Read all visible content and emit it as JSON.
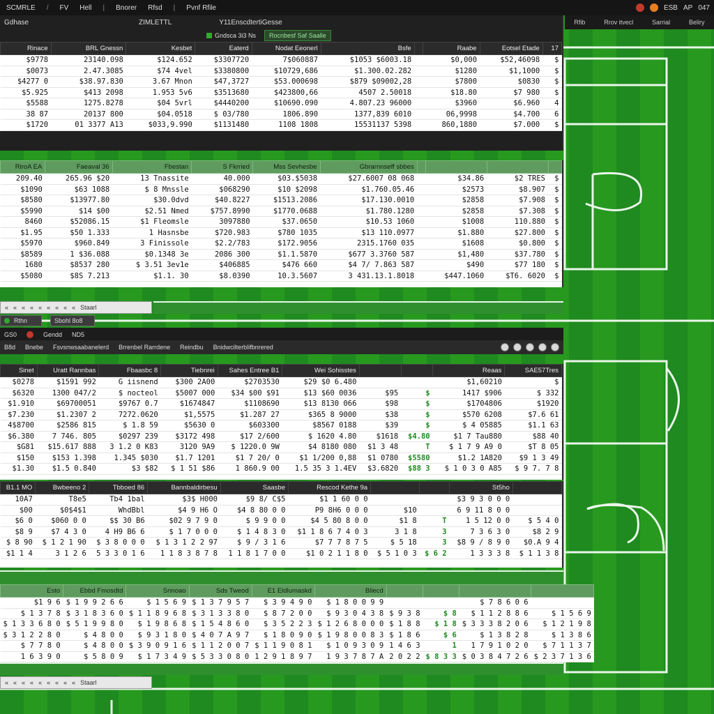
{
  "topbar": {
    "menu": [
      "SCMRLE",
      "/",
      "FV",
      "Hell",
      "|",
      "Bnorer",
      "Rfsd",
      "|",
      "Pvnf Rfile"
    ],
    "right_text": [
      "ESB",
      "AP",
      "047"
    ]
  },
  "subbar_right": [
    "Rfib",
    "Rrov itvecl",
    "Sarrial",
    "Beliry"
  ],
  "panel1": {
    "head_left": "Gdhase",
    "head_mid": "ZIMLETTL",
    "head_right": "Y11EnscdtertiGesse",
    "tab_a": "Gndsca 3i3 Ns",
    "tab_b": "Rocnbesf Saf Saalle",
    "columns": [
      "Rinace",
      "BRL Gnessn",
      "Kesbet",
      "Eaterd",
      "Nodat Eeonerl",
      "Bsfe",
      "",
      "Raabe",
      "Eotsel Etade",
      "17"
    ],
    "rows": [
      [
        "$9778",
        "23140.098",
        "$124.652",
        "$3307720",
        "7$060887",
        "$1053 $6003.18",
        "",
        "$0,000",
        "$52,46098",
        "$"
      ],
      [
        "$0073",
        "2.47.3085",
        "$74 4vel",
        "$3380800",
        "$10729,686",
        "$1.300.02.282",
        "",
        "$1280",
        "$1,1000",
        "$"
      ],
      [
        "$4277 0",
        "$38.97.830",
        "3.67 Mnon",
        "$47,3727",
        "$53.000698",
        "$879 $09002,28",
        "",
        "$7800",
        "$0830",
        "$"
      ],
      [
        "$5.925",
        "$413 2098",
        "1.953 5v6",
        "$3513680",
        "$423800,66",
        "4507 2.50018",
        "",
        "$18.80",
        "$7 980",
        "$"
      ],
      [
        "$5588",
        "1275.8278",
        "$04 5vrl",
        "$4440200",
        "$10690.090",
        "4.807.23 96000",
        "",
        "$3960",
        "$6.960",
        "4"
      ],
      [
        "38 87",
        "20137 800",
        "$04.0518",
        "$ 03/780",
        "1806.890",
        "1377,839 6010",
        "",
        "06,9998",
        "$4.700",
        "6"
      ],
      [
        "$1720",
        "01 3377 A13",
        "$033,9.990",
        "$1131480",
        "1108 1808",
        "15531137 5398",
        "",
        "860,1880",
        "$7.000",
        "$"
      ]
    ]
  },
  "panel2": {
    "columns": [
      "RiroA EA",
      "Faeaval 36",
      "Fbestan",
      "S Fkrried",
      "Mss Sevhesbe",
      "Gbrarnnseff sbbes",
      "",
      "",
      "",
      ""
    ],
    "rows": [
      [
        "209.40",
        "265.96 $20",
        "13 Tnassite",
        "40.000",
        "$03.$5038",
        "$27.6007 08 068",
        "",
        "$34.86",
        "$2 TRES",
        "$"
      ],
      [
        "$1090",
        "$63 1088",
        "$ 8 Mnssle",
        "$068290",
        "$10 $2098",
        "$1.760.05.46",
        "",
        "$2573",
        "$8.907",
        "$"
      ],
      [
        "$8580",
        "$13977.80",
        "$30.0dvd",
        "$40.8227",
        "$1513.2086",
        "$17.130.0010",
        "",
        "$2858",
        "$7.908",
        "$"
      ],
      [
        "$5990",
        "$14 $00",
        "$2.51 Nmed",
        "$757.8990",
        "$1770.0688",
        "$1.780.1280",
        "",
        "$2858",
        "$7.308",
        "$"
      ],
      [
        "8460",
        "$52086.15",
        "$1 Fleomsle",
        "3097880",
        "$37.0650",
        "$10.53 1060",
        "",
        "$1008",
        "110.880",
        "$"
      ],
      [
        "$1.95",
        "$50 1.333",
        "1 Hasnsbe",
        "$720.983",
        "$780 1035",
        "$13 110.0977",
        "",
        "$1.880",
        "$27.800",
        "$"
      ],
      [
        "$5970",
        "$960.849",
        "3 Finissole",
        "$2.2/783",
        "$172.9056",
        "2315.1760 035",
        "",
        "$1608",
        "$0.800",
        "$"
      ],
      [
        "$8589",
        "1 $36.088",
        "$0.1348 3e",
        "2086 300",
        "$1.1.5870",
        "$677 3.3760 587",
        "",
        "$1,480",
        "$37.780",
        "$"
      ],
      [
        "1680",
        "$8537 280",
        "$ 3.51 3ev1e",
        "$406885",
        "$476 660",
        "$4 7/ 7.863 587",
        "",
        "$490",
        "$77 180",
        "$"
      ],
      [
        "$5080",
        "$8S 7.213",
        "$1.1. 30",
        "$8.0390",
        "10.3.5607",
        "3 431.13.1.8018",
        "",
        "$447.1060",
        "$T6. 6020",
        "$"
      ]
    ]
  },
  "mini_tabs_1": [
    "«",
    "«",
    "«",
    "«",
    "«",
    "«",
    "«",
    "«",
    "«",
    "Staarl"
  ],
  "section2": {
    "sel_left": "Rthn",
    "sel_right": "Sbohl 8o8",
    "toolbar_a": [
      "GS0",
      "Gendd",
      "ND5"
    ],
    "toolbar_b": [
      "B8d",
      "Bnebe",
      "Fsvsnwsaabanelerd",
      "Brrenbel Rarrdene",
      "Reindbu",
      "Bnidwcilterblifbnrered"
    ]
  },
  "panel3": {
    "columns": [
      "Sinet",
      "Uratt Rannbas",
      "Fbaasbc 8",
      "Tiebnrei",
      "Sahes Entree B1",
      "Wei Sohisstes",
      "",
      "",
      "Reaas",
      "SAE57Tres"
    ],
    "rows": [
      [
        "$0278",
        "$1591 992",
        "G iisnend",
        "$300 2A00",
        "$2703530",
        "$29 $0 6.480",
        "",
        "",
        "$1,60210",
        "$"
      ],
      [
        "$6320",
        "1300 047/2",
        "$ nocteol",
        "$5007 000",
        "$34 $00 $91",
        "$13 $60 0036",
        "$95",
        "$",
        "1417 $906",
        "$ 332"
      ],
      [
        "$1.910",
        "$69700051",
        "$9767 0.7",
        "$1674847",
        "$1108690",
        "$13 8130 066",
        "$98",
        "$",
        "$1704806",
        "$1920"
      ],
      [
        "$7.230",
        "$1.2307 2",
        "7272.0620",
        "$1,5575",
        "$1.287 27",
        "$365 8 9000",
        "$38",
        "$",
        "$570 6208",
        "$7.6 61"
      ],
      [
        "4$8700",
        "$2586 815",
        "$ 1.8 59",
        "$5630 0",
        "$603300",
        "$8567 0188",
        "$39",
        "$",
        "$ 4 05885",
        "$1.1 63"
      ],
      [
        "$6.380",
        "7 746. 805",
        "$0297 239",
        "$3172 498",
        "$17 2/600",
        "$ 1620 4.80",
        "$1618",
        "$4.80",
        "$1 7 Tau880",
        "$88 40"
      ],
      [
        "$G81",
        "$15.617 888",
        "3 1.2 0 K83",
        "3120 9A9",
        "$ 1220.0 9W",
        "$4 8180 080",
        "$1 3 48",
        "T",
        "$ 1 7 9 A9 0",
        "$T 8 05"
      ],
      [
        "$150",
        "$153 1.398",
        "1.345 $030",
        "$1.7 1201",
        "$1 7 20/ 0",
        "$1 1/200 0,88",
        "$1 0780",
        "$5580",
        "$1.2 1A820",
        "$9 1 3 49"
      ],
      [
        "$1.30",
        "$1.5 0.840",
        "$3 $82",
        "$ 1 51 $86",
        "1 860.9 00",
        "1.5 35 3 1.4EV",
        "$3.6820",
        "$88 3",
        "$ 1 0 3 0 A85",
        "$ 9 7. 7 8"
      ]
    ]
  },
  "panel4": {
    "columns": [
      "B1.1 MO",
      "Bwbeeno 2",
      "Tbboed 86",
      "Bannbaldirbesu",
      "Saasbe",
      "Rescod Kethe 9a",
      "",
      "",
      "St5ho",
      ""
    ],
    "rows": [
      [
        "10A7",
        "T8e5",
        "Tb4 1bal",
        "$3$ H000",
        "$9 8/ C$5",
        "$1 1 60 0 0",
        "",
        "",
        "$3 9 3 0 0 0",
        ""
      ],
      [
        "$00",
        "$0$4$1",
        "WhdBbl",
        "$4 9 H6 O",
        "$4 8 80 0 0",
        "P9 8H6 0 0 0",
        "$10",
        "",
        "6 9 11 8 0 0",
        ""
      ],
      [
        "$6 0",
        "$060 0 0",
        "$$ 30 B6",
        "$02 9 7 9 0",
        "$ 9 9 0 0",
        "$4 5 80 8 0 0",
        "$1 8",
        "T",
        "1 5 12 0 0",
        "$ 5 4 0"
      ],
      [
        "$8 9",
        "$7 4 3 0",
        "4 H9 B6 6",
        "$ 1 7 0 0 0",
        "$ 1 4 8 3 0",
        "$1 1 8 6 7 4 0 3",
        "3 1 8",
        "3",
        "7 3 6 3 0",
        "$8 2 9"
      ],
      [
        "$ 8 90",
        "$ 1 2 1 90",
        "$ 3 8 0 0 0",
        "$ 1 3 1 2 2 97",
        "$ 9 / 3 1 6",
        "$7 7 7 8 7 5",
        "$ 5 18",
        "3",
        "$8 9 / 8 9 0",
        "$0.A 9 4"
      ],
      [
        "$1 1 4",
        "3 1 2 6",
        "5 3 3 0 1 6",
        "1 1 8 3 8 7 8",
        "1 1 8 1 7 0 0",
        "$1 0 2 1 1 8 0",
        "$ 5 1 0 3",
        "$ 6 2",
        "1 3 3 3 8",
        "$ 1 1 3 8"
      ]
    ]
  },
  "panel5": {
    "columns": [
      "Esto",
      "Ebbd Fmosdtd",
      "Snnoao",
      "Sds Tweod",
      "E1 Eldlumaskd",
      "Bliecd",
      "",
      "",
      "",
      ""
    ],
    "rows": [
      [
        "$1 9 6",
        "$ 1 9 9 2 6 6",
        "$ 1 5 6 9",
        "$ 1 3 7 9 5 7",
        "$ 3 9 4 9 0",
        "$ 1 8 0 0 9 9",
        "",
        "",
        "$ 7 8 6 0 6",
        ""
      ],
      [
        "$ 1 3 7 8",
        "$ 3 1 8 3 6 0",
        "$ 1 1 8 9 6 8",
        "$ 3 1 3 3 8 0",
        "$ 8 7 2 0 0",
        "$ 9 3 0 4 3 8",
        "$ 9 3 8",
        "$ 8",
        "$ 1 1 2 8 8 6",
        "$ 1 5 6 9"
      ],
      [
        "$ 1 3 3 6 8 0",
        "$ 5 1 9 9 8 0",
        "$ 1 9 8 6 8",
        "$ 1 5 4 8 6 0",
        "$ 3 5 2 2 3",
        "$ 1 2 6 8 0 0 0",
        "$ 1 8 8",
        "$ 1 8",
        "$ 3 3 3 8 2 0 6",
        "$ 1 2 1 9 8"
      ],
      [
        "$ 3 1 2 2 8 0",
        "$ 4 8 0 0",
        "$ 9 3 1 8 0",
        "$ 4 0 7 A 9 7",
        "$ 1 8 0 9 0",
        "$ 1 9 8 0 0 8 3",
        "$ 1 8 6",
        "$ 6",
        "$ 1 3 8 2 8",
        "$ 1 3 8 6"
      ],
      [
        "$ 7 7 8 0",
        "$ 4 8 0 0",
        "$ 3 9 0 9 1 6",
        "$ 1 1 2 0 0 7",
        "$ 1 1 9 0 8 1",
        "$ 1 0 9 3 0 9",
        "1 4 6 3",
        "1",
        "1 7 9 1 0 2 0",
        "$ 7 1 1 3 7"
      ],
      [
        "1 6 3 9 0",
        "$ 5 8 0 9",
        "$ 1 7 3 4 9",
        "$ 5 3 3 0 8 0",
        "1 2 9 1 8 9 7",
        "1 9 3 7 8 7 A",
        "2 0 2 2",
        "$ 8 3 3",
        "$ 0 3 8 4 7 2 6",
        "$ 2 3 7 1 3 6"
      ]
    ]
  },
  "mini_tabs_2": [
    "«",
    "«",
    "«",
    "«",
    "«",
    "«",
    "«",
    "«",
    "«",
    "Staarl"
  ],
  "colors": {
    "pitch_light": "#27991f",
    "pitch_dark": "#1f8a1f",
    "header_dark": "#2b2b2b",
    "header_green": "#5f9b5f",
    "value_green": "#1f8a1f"
  }
}
